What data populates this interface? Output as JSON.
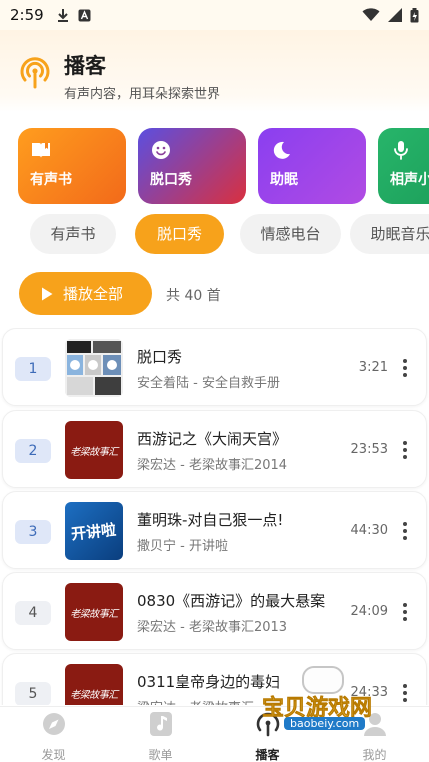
{
  "status_bar": {
    "time": "2:59",
    "icons": [
      "download-icon",
      "app-notification-icon",
      "wifi-icon",
      "signal-icon",
      "battery-icon"
    ]
  },
  "header": {
    "title": "播客",
    "subtitle": "有声内容，用耳朵探索世界",
    "icon": "podcast-icon",
    "accent_color": "#f7a21b"
  },
  "categories": [
    {
      "label": "有声书",
      "icon": "book-icon",
      "gradient": [
        "#ff9d1e",
        "#f26a1a"
      ]
    },
    {
      "label": "脱口秀",
      "icon": "smile-icon",
      "gradient": [
        "#5b4fe0",
        "#d9303f"
      ]
    },
    {
      "label": "助眠",
      "icon": "moon-icon",
      "gradient": [
        "#8a3ff0",
        "#b14be3"
      ]
    },
    {
      "label": "相声小品",
      "icon": "mic-icon",
      "gradient": [
        "#27b56a",
        "#1a9a57"
      ]
    }
  ],
  "filter_chips": [
    {
      "label": "有声书",
      "active": false
    },
    {
      "label": "脱口秀",
      "active": true
    },
    {
      "label": "情感电台",
      "active": false
    },
    {
      "label": "助眠音乐",
      "active": false
    }
  ],
  "play_all": {
    "label": "播放全部",
    "count_text": "共 40 首"
  },
  "tracks": [
    {
      "index": "1",
      "title": "脱口秀",
      "subtitle": "安全着陆 - 安全自救手册",
      "duration": "3:21",
      "cover": "collage",
      "highlighted": true
    },
    {
      "index": "2",
      "title": "西游记之《大闹天宫》",
      "subtitle": "梁宏达 - 老梁故事汇2014",
      "duration": "23:53",
      "cover": "red",
      "cover_text": "老梁故事汇",
      "highlighted": true
    },
    {
      "index": "3",
      "title": "董明珠-对自己狠一点!",
      "subtitle": "撒贝宁 - 开讲啦",
      "duration": "44:30",
      "cover": "blue",
      "cover_text": "开讲啦",
      "highlighted": true
    },
    {
      "index": "4",
      "title": "0830《西游记》的最大悬案",
      "subtitle": "梁宏达 - 老梁故事汇2013",
      "duration": "24:09",
      "cover": "red",
      "cover_text": "老梁故事汇",
      "highlighted": false
    },
    {
      "index": "5",
      "title": "0311皇帝身边的毒妇",
      "subtitle": "梁宏达 - 老梁故事汇",
      "duration": "24:33",
      "cover": "red",
      "cover_text": "老梁故事汇",
      "highlighted": false
    }
  ],
  "tab_bar": [
    {
      "label": "发现",
      "icon": "compass-icon",
      "active": false
    },
    {
      "label": "歌单",
      "icon": "music-note-icon",
      "active": false
    },
    {
      "label": "播客",
      "icon": "podcast-icon",
      "active": true
    },
    {
      "label": "我的",
      "icon": "user-icon",
      "active": false
    }
  ],
  "watermark": {
    "text": "宝贝游戏网",
    "url": "baobeiy.com"
  }
}
